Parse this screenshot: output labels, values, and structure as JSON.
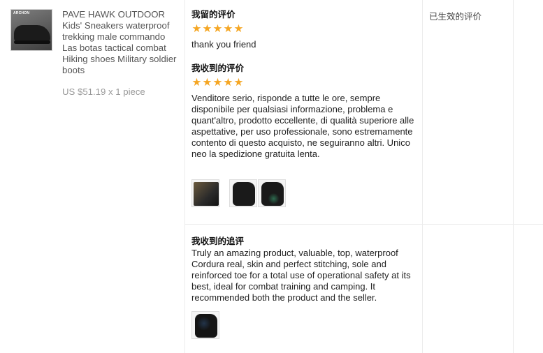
{
  "product": {
    "thumbnail_brand": "ARCHON",
    "title": "PAVE HAWK OUTDOOR Kids' Sneakers waterproof trekking male commando Las botas tactical combat Hiking shoes Military soldier boots",
    "price": "US $51.19 x 1 piece"
  },
  "reviews": {
    "my_review": {
      "heading": "我留的评价",
      "rating": 5,
      "text": "thank you friend"
    },
    "received_review": {
      "heading": "我收到的评价",
      "rating": 5,
      "text": "Venditore serio, risponde a tutte le ore, sempre disponibile per qualsiasi informazione, problema e quant'altro, prodotto eccellente, di qualità superiore alle aspettative, per uso professionale, sono estremamente contento di questo acquisto, ne seguiranno altri. Unico neo la spedizione gratuita lenta.",
      "photo_count": 3
    },
    "followup_review": {
      "heading": "我收到的追评",
      "text": "Truly an amazing product, valuable, top, waterproof Cordura real, skin and perfect stitching, sole and reinforced toe for a total use of operational safety at its best, ideal for combat training and camping. It recommended both the product and the seller.",
      "photo_count": 1
    }
  },
  "status": {
    "label": "已生效的评价"
  },
  "colors": {
    "star": "#f5a623",
    "price": "#999999",
    "divider": "#ececec"
  },
  "icons": {
    "star": "star-icon"
  }
}
